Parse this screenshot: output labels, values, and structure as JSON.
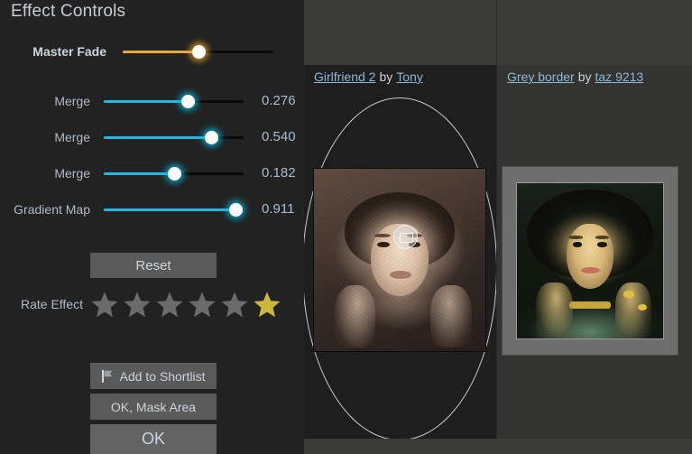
{
  "panel": {
    "title": "Effect Controls"
  },
  "master_fade": {
    "label": "Master Fade",
    "accent_color": "#e9a93a",
    "position_pct": 50
  },
  "sliders": [
    {
      "label": "Merge",
      "value": "0.276",
      "position_pct": 60,
      "accent_color": "#1fb8e0"
    },
    {
      "label": "Merge",
      "value": "0.540",
      "position_pct": 77,
      "accent_color": "#1fb8e0"
    },
    {
      "label": "Merge",
      "value": "0.182",
      "position_pct": 50,
      "accent_color": "#1fb8e0"
    },
    {
      "label": "Gradient Map",
      "value": "0.911",
      "position_pct": 94,
      "accent_color": "#1fb8e0"
    }
  ],
  "buttons": {
    "reset": "Reset",
    "shortlist": "Add to Shortlist",
    "mask_area": "OK, Mask Area",
    "ok": "OK"
  },
  "rating": {
    "label": "Rate Effect",
    "star_count": 6,
    "highlighted_index": 5,
    "star_color_off": "#6b6b6b",
    "star_color_on": "#ccb63c"
  },
  "previews": {
    "left": {
      "title": "Girlfriend 2",
      "by": "by",
      "author": "Tony"
    },
    "right": {
      "title": "Grey border",
      "by": "by",
      "author": "taz 9213"
    }
  }
}
